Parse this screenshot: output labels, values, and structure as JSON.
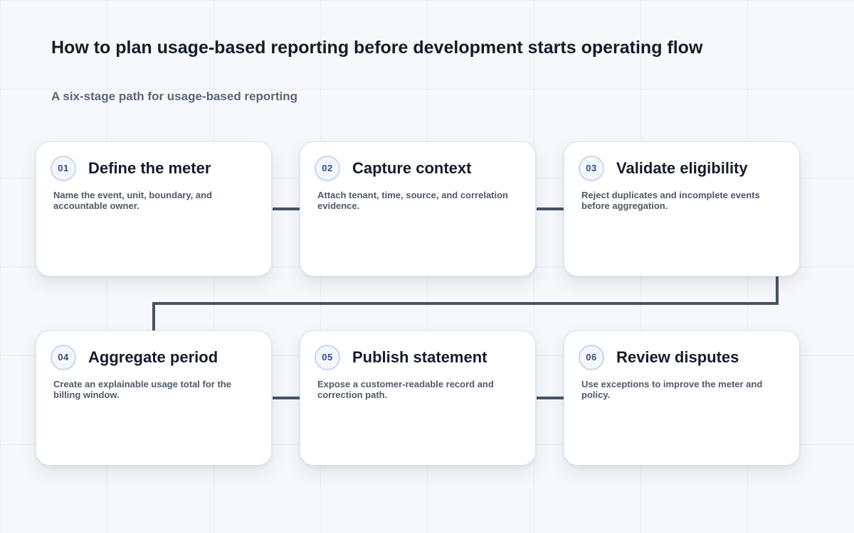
{
  "header": {
    "title": "How to plan usage-based reporting before development starts operating flow",
    "subtitle": "A six-stage path for usage-based reporting"
  },
  "steps": [
    {
      "number": "01",
      "title": "Define the meter",
      "description": "Name the event, unit, boundary, and accountable owner."
    },
    {
      "number": "02",
      "title": "Capture context",
      "description": "Attach tenant, time, source, and correlation evidence."
    },
    {
      "number": "03",
      "title": "Validate eligibility",
      "description": "Reject duplicates and incomplete events before aggregation."
    },
    {
      "number": "04",
      "title": "Aggregate period",
      "description": "Create an explainable usage total for the billing window."
    },
    {
      "number": "05",
      "title": "Publish statement",
      "description": "Expose a customer-readable record and correction path."
    },
    {
      "number": "06",
      "title": "Review disputes",
      "description": "Use exceptions to improve the meter and policy."
    }
  ],
  "colors": {
    "connector": "#465366",
    "badge_text": "#2f4d8a",
    "title_text": "#141c2b"
  }
}
